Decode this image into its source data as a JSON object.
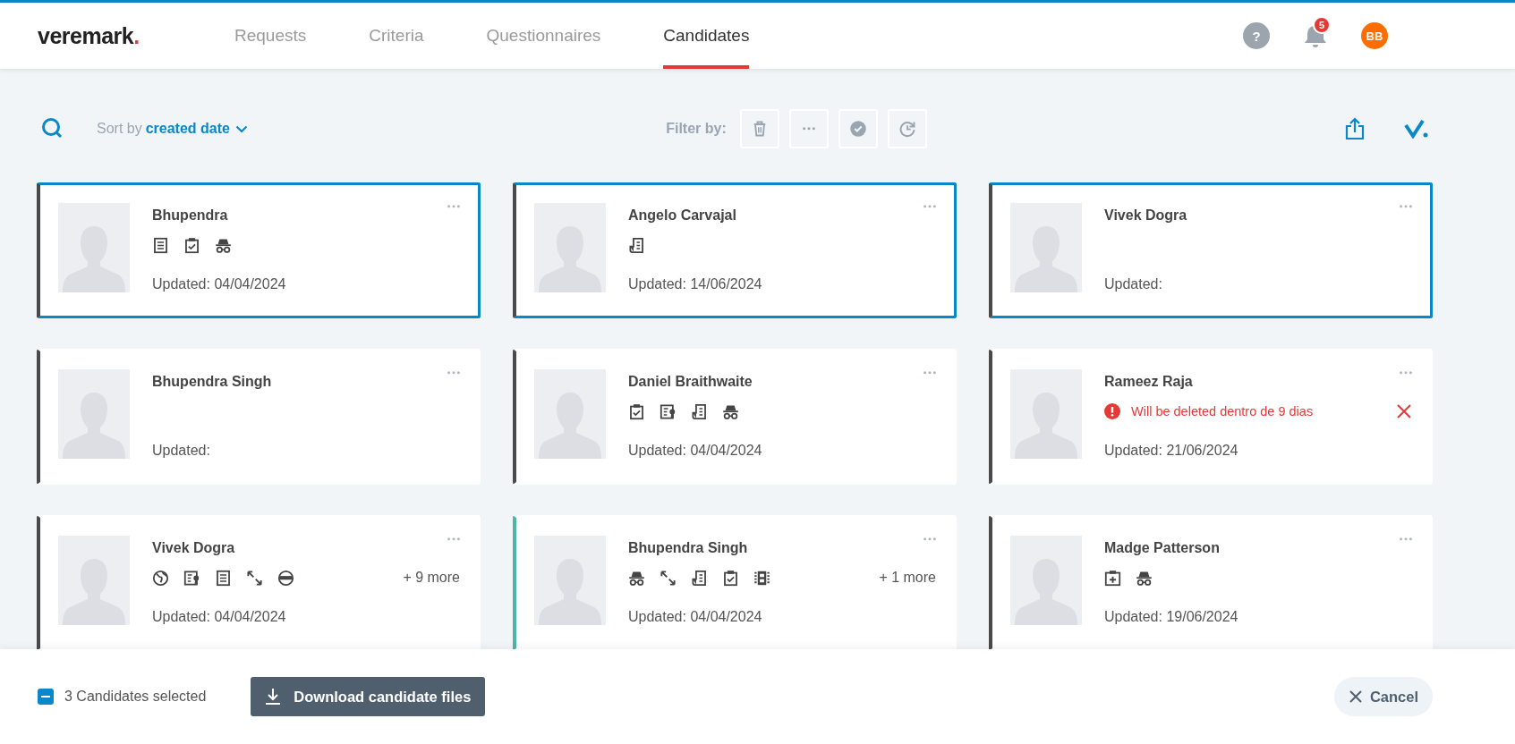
{
  "header": {
    "logo": {
      "text": "veremark",
      "mark": "."
    },
    "tabs": [
      {
        "label": "Requests",
        "selected": false
      },
      {
        "label": "Criteria",
        "selected": false
      },
      {
        "label": "Questionnaires",
        "selected": false
      },
      {
        "label": "Candidates",
        "selected": true
      }
    ],
    "help": "?",
    "notifications": "5",
    "avatar": "BB"
  },
  "toolbar": {
    "sort_label": "Sort by",
    "sort_value": "created date",
    "filter_label": "Filter by:",
    "filters": [
      {
        "kind": "trash"
      },
      {
        "kind": "more"
      },
      {
        "kind": "check"
      },
      {
        "kind": "history"
      }
    ]
  },
  "candidates": [
    {
      "name": "Bhupendra",
      "selected": true,
      "color": "#4a4a4a",
      "icons": [
        {
          "kind": "document"
        },
        {
          "kind": "clipboard"
        },
        {
          "kind": "spy"
        }
      ],
      "updated": "Updated: 04/04/2024"
    },
    {
      "name": "Angelo Carvajal",
      "selected": true,
      "color": "#4a4a4a",
      "icons": [
        {
          "kind": "receipt"
        }
      ],
      "updated": "Updated: 14/06/2024"
    },
    {
      "name": "Vivek Dogra",
      "selected": true,
      "color": "#4a4a4a",
      "updated": "Updated:"
    },
    {
      "name": "Bhupendra Singh",
      "selected": false,
      "color": "#4a4a4a",
      "updated": "Updated:"
    },
    {
      "name": "Daniel Braithwaite",
      "selected": false,
      "color": "#4a4a4a",
      "icons": [
        {
          "kind": "clipboard"
        },
        {
          "kind": "badge-doc"
        },
        {
          "kind": "receipt"
        },
        {
          "kind": "spy"
        }
      ],
      "updated": "Updated: 04/04/2024"
    },
    {
      "name": "Rameez Raja",
      "selected": false,
      "color": "#4a4a4a",
      "warning": "Will be deleted dentro de 9 dias",
      "updated": "Updated: 21/06/2024"
    },
    {
      "name": "Vivek Dogra",
      "selected": false,
      "color": "#4a4a4a",
      "icons": [
        {
          "kind": "globe"
        },
        {
          "kind": "badge-doc"
        },
        {
          "kind": "document"
        },
        {
          "kind": "expand"
        },
        {
          "kind": "helmet"
        }
      ],
      "more": "+ 9 more",
      "updated": "Updated: 04/04/2024"
    },
    {
      "name": "Bhupendra Singh",
      "selected": false,
      "color": "#4db6a4",
      "icons": [
        {
          "kind": "spy"
        },
        {
          "kind": "expand"
        },
        {
          "kind": "receipt"
        },
        {
          "kind": "clipboard"
        },
        {
          "kind": "film"
        }
      ],
      "more": "+ 1 more",
      "updated": "Updated: 04/04/2024"
    },
    {
      "name": "Madge Patterson",
      "selected": false,
      "color": "#4a4a4a",
      "icons": [
        {
          "kind": "medical"
        },
        {
          "kind": "spy"
        }
      ],
      "updated": "Updated: 19/06/2024"
    }
  ],
  "footer": {
    "indeterminate": true,
    "selection": "3 Candidates selected",
    "download": "Download candidate files",
    "cancel": "Cancel"
  }
}
